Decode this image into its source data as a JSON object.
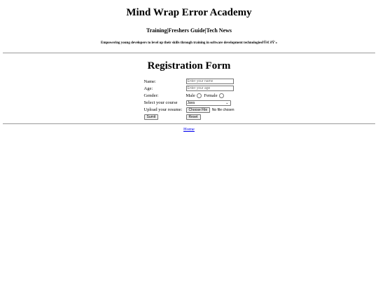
{
  "header": {
    "title": "Mind Wrap Error Academy",
    "nav": "Training|Freshers Guide|Tech News",
    "tagline": "Empowering young developers to level up their skills through training in software development technologiesðŸš€ ðŸ'»"
  },
  "form": {
    "title": "Registration Form",
    "name_label": "Name:",
    "name_placeholder": "Enter your name",
    "age_label": "Age:",
    "age_placeholder": "Enter your age",
    "gender_label": "Gender:",
    "gender_male": "Male",
    "gender_female": "Female",
    "course_label": "Select your course",
    "course_selected": "Java",
    "resume_label": "Upload your resume:",
    "file_button": "Choose File",
    "file_status": "No file chosen",
    "submit_label": "Sumit",
    "reset_label": "Reset"
  },
  "footer": {
    "home_link": "Home"
  }
}
